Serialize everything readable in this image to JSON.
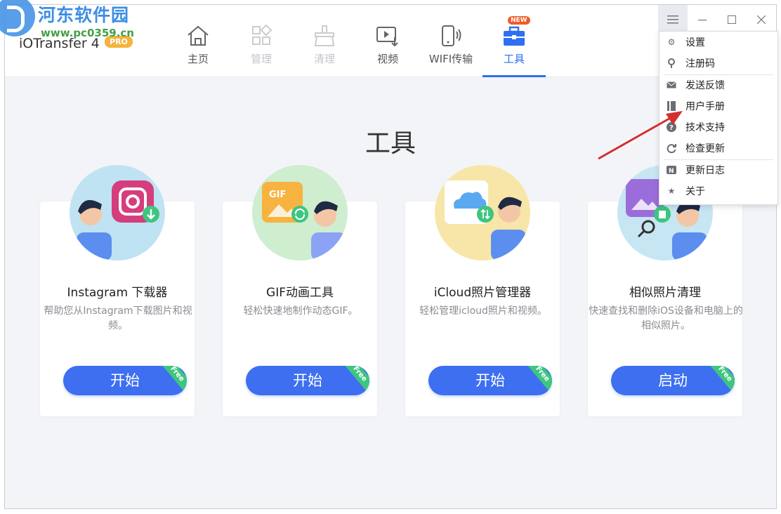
{
  "watermark": {
    "title": "河东软件园",
    "url": "www.pc0359.cn"
  },
  "app": {
    "name": "iOTransfer 4",
    "badge": "PRO"
  },
  "nav": [
    {
      "label": "主页",
      "icon": "home-icon",
      "state": "normal"
    },
    {
      "label": "管理",
      "icon": "grid-icon",
      "state": "disabled"
    },
    {
      "label": "清理",
      "icon": "broom-icon",
      "state": "disabled"
    },
    {
      "label": "视频",
      "icon": "video-download-icon",
      "state": "normal"
    },
    {
      "label": "WIFI传输",
      "icon": "wifi-phone-icon",
      "state": "normal"
    },
    {
      "label": "工具",
      "icon": "toolbox-icon",
      "state": "active",
      "badge": "NEW"
    }
  ],
  "page_title": "工具",
  "cards": [
    {
      "title": "Instagram 下载器",
      "desc": "帮助您从Instagram下载图片和视频。",
      "button": "开始",
      "ribbon": "Free",
      "illustration": "instagram-download-illustration"
    },
    {
      "title": "GIF动画工具",
      "desc": "轻松快速地制作动态GIF。",
      "button": "开始",
      "ribbon": "Free",
      "illustration": "gif-maker-illustration"
    },
    {
      "title": "iCloud照片管理器",
      "desc": "轻松管理icloud照片和视频。",
      "button": "开始",
      "ribbon": "Free",
      "illustration": "icloud-photo-illustration"
    },
    {
      "title": "相似照片清理",
      "desc": "快速查找和删除iOS设备和电脑上的相似照片。",
      "button": "启动",
      "ribbon": "Free",
      "illustration": "similar-photo-illustration"
    }
  ],
  "menu": [
    {
      "label": "设置",
      "icon": "gear-icon"
    },
    {
      "label": "注册码",
      "icon": "key-icon"
    },
    {
      "label": "发送反馈",
      "icon": "mail-icon"
    },
    {
      "label": "用户手册",
      "icon": "book-icon"
    },
    {
      "label": "技术支持",
      "icon": "help-icon"
    },
    {
      "label": "检查更新",
      "icon": "refresh-icon"
    },
    {
      "label": "更新日志",
      "icon": "news-icon"
    },
    {
      "label": "关于",
      "icon": "star-icon"
    }
  ],
  "colors": {
    "accent": "#2f6ff2",
    "button": "#3d6ff0",
    "ribbon": "#3ec57f",
    "new_badge": "#f15a24",
    "annotation_arrow": "#d32f2f"
  }
}
